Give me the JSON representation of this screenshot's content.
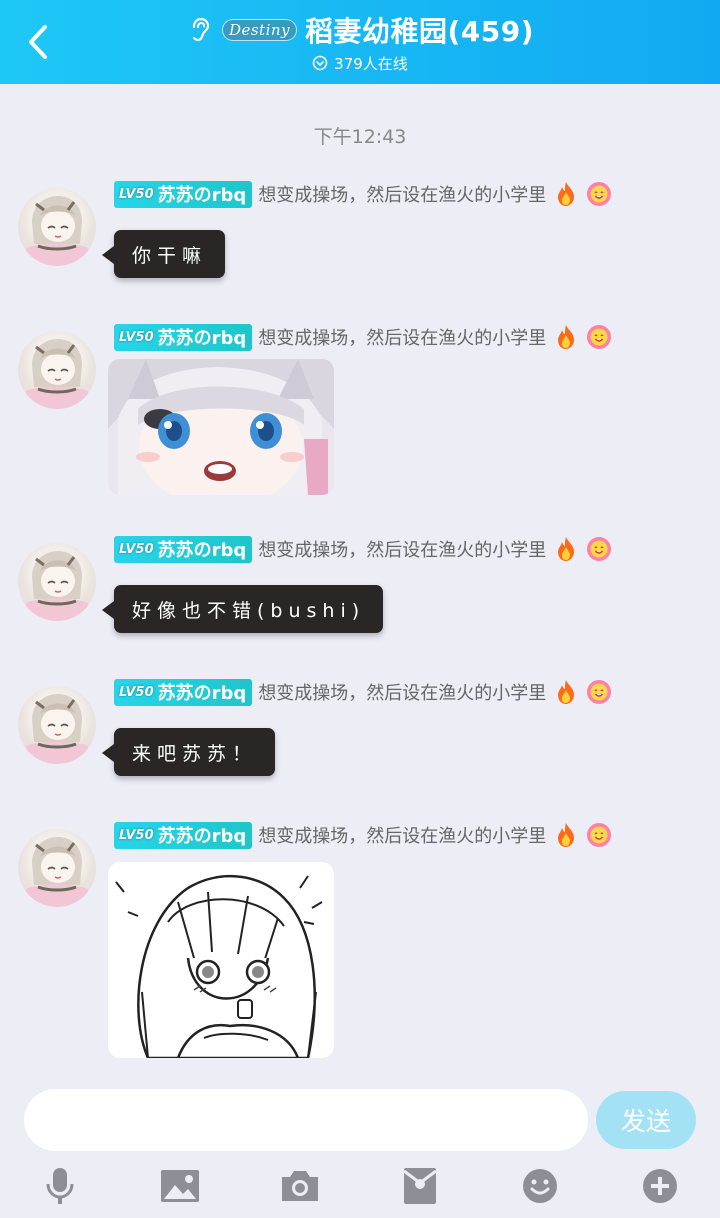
{
  "header": {
    "title": "稻妻幼稚园(459)",
    "logo_text": "Destiny",
    "online_text": "379人在线"
  },
  "chat": {
    "timestamp": "下午12:43",
    "messages": [
      {
        "level": "LV50",
        "nickname": "苏苏のrbq",
        "tagline": "想变成操场，然后设在渔火的小学里",
        "type": "text",
        "text": "你干嘛"
      },
      {
        "level": "LV50",
        "nickname": "苏苏のrbq",
        "tagline": "想变成操场，然后设在渔火的小学里",
        "type": "image",
        "image": "anime-girl-surprised"
      },
      {
        "level": "LV50",
        "nickname": "苏苏のrbq",
        "tagline": "想变成操场，然后设在渔火的小学里",
        "type": "text",
        "text": "好像也不错(bushi)"
      },
      {
        "level": "LV50",
        "nickname": "苏苏のrbq",
        "tagline": "想变成操场，然后设在渔火的小学里",
        "type": "text",
        "text": "来吧苏苏！"
      },
      {
        "level": "LV50",
        "nickname": "苏苏のrbq",
        "tagline": "想变成操场，然后设在渔火的小学里",
        "type": "image",
        "image": "manga-girl-shocked"
      }
    ]
  },
  "input": {
    "value": "",
    "send_label": "发送"
  },
  "toolbar": [
    "microphone-icon",
    "image-icon",
    "camera-icon",
    "red-packet-icon",
    "emoji-icon",
    "plus-icon"
  ],
  "colors": {
    "header": "#18b8f4",
    "badge": "#28d4e8",
    "bubble": "#2a2626",
    "send": "#a3e2f5",
    "background": "#ecedf5"
  }
}
